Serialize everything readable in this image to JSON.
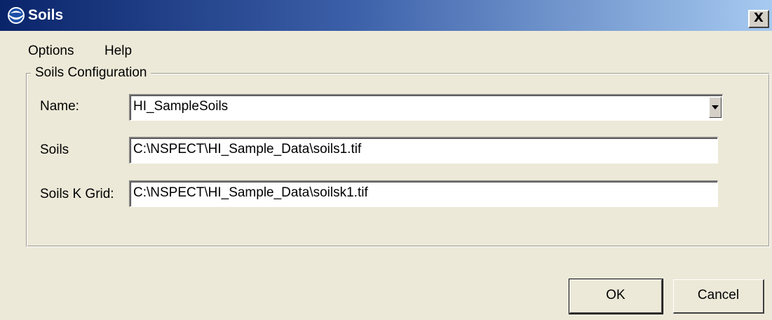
{
  "window": {
    "title": "Soils",
    "close_label": "X"
  },
  "menu": {
    "options": "Options",
    "help": "Help"
  },
  "soils_configuration": {
    "group_title": "Soils Configuration",
    "name_label": "Name:",
    "name_value": "HI_SampleSoils",
    "soils_label": "Soils",
    "soils_value": "C:\\NSPECT\\HI_Sample_Data\\soils1.tif",
    "soilsk_label": "Soils K Grid:",
    "soilsk_value": "C:\\NSPECT\\HI_Sample_Data\\soilsk1.tif"
  },
  "buttons": {
    "ok": "OK",
    "cancel": "Cancel"
  },
  "icons": {
    "app_icon": "noaa-logo-icon",
    "dropdown": "chevron-down-icon"
  }
}
